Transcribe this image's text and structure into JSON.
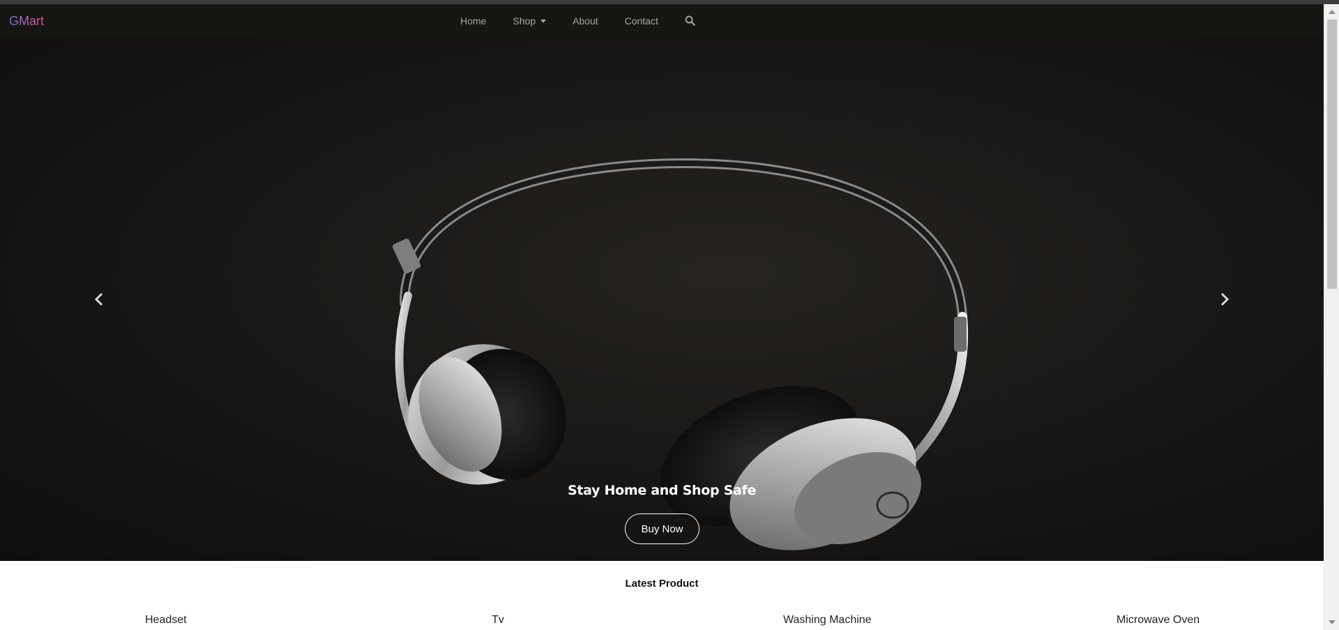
{
  "brand": "GMart",
  "nav": {
    "home": "Home",
    "shop": "Shop",
    "about": "About",
    "contact": "Contact"
  },
  "hero": {
    "caption": "Stay Home and Shop Safe",
    "button_label": "Buy Now"
  },
  "latest": {
    "title": "Latest Product",
    "products": [
      "Headset",
      "Tv",
      "Washing Machine",
      "Microwave Oven"
    ]
  },
  "icons": {
    "search": "search-icon",
    "prev": "chevron-left-icon",
    "next": "chevron-right-icon",
    "shop_dropdown": "caret-down-icon"
  },
  "colors": {
    "navbar_bg": "#151512",
    "nav_text": "#a7a7a7",
    "hero_bg": "#1a1816",
    "brand_gradient_start": "#6f74d6",
    "brand_gradient_end": "#d8588f"
  }
}
